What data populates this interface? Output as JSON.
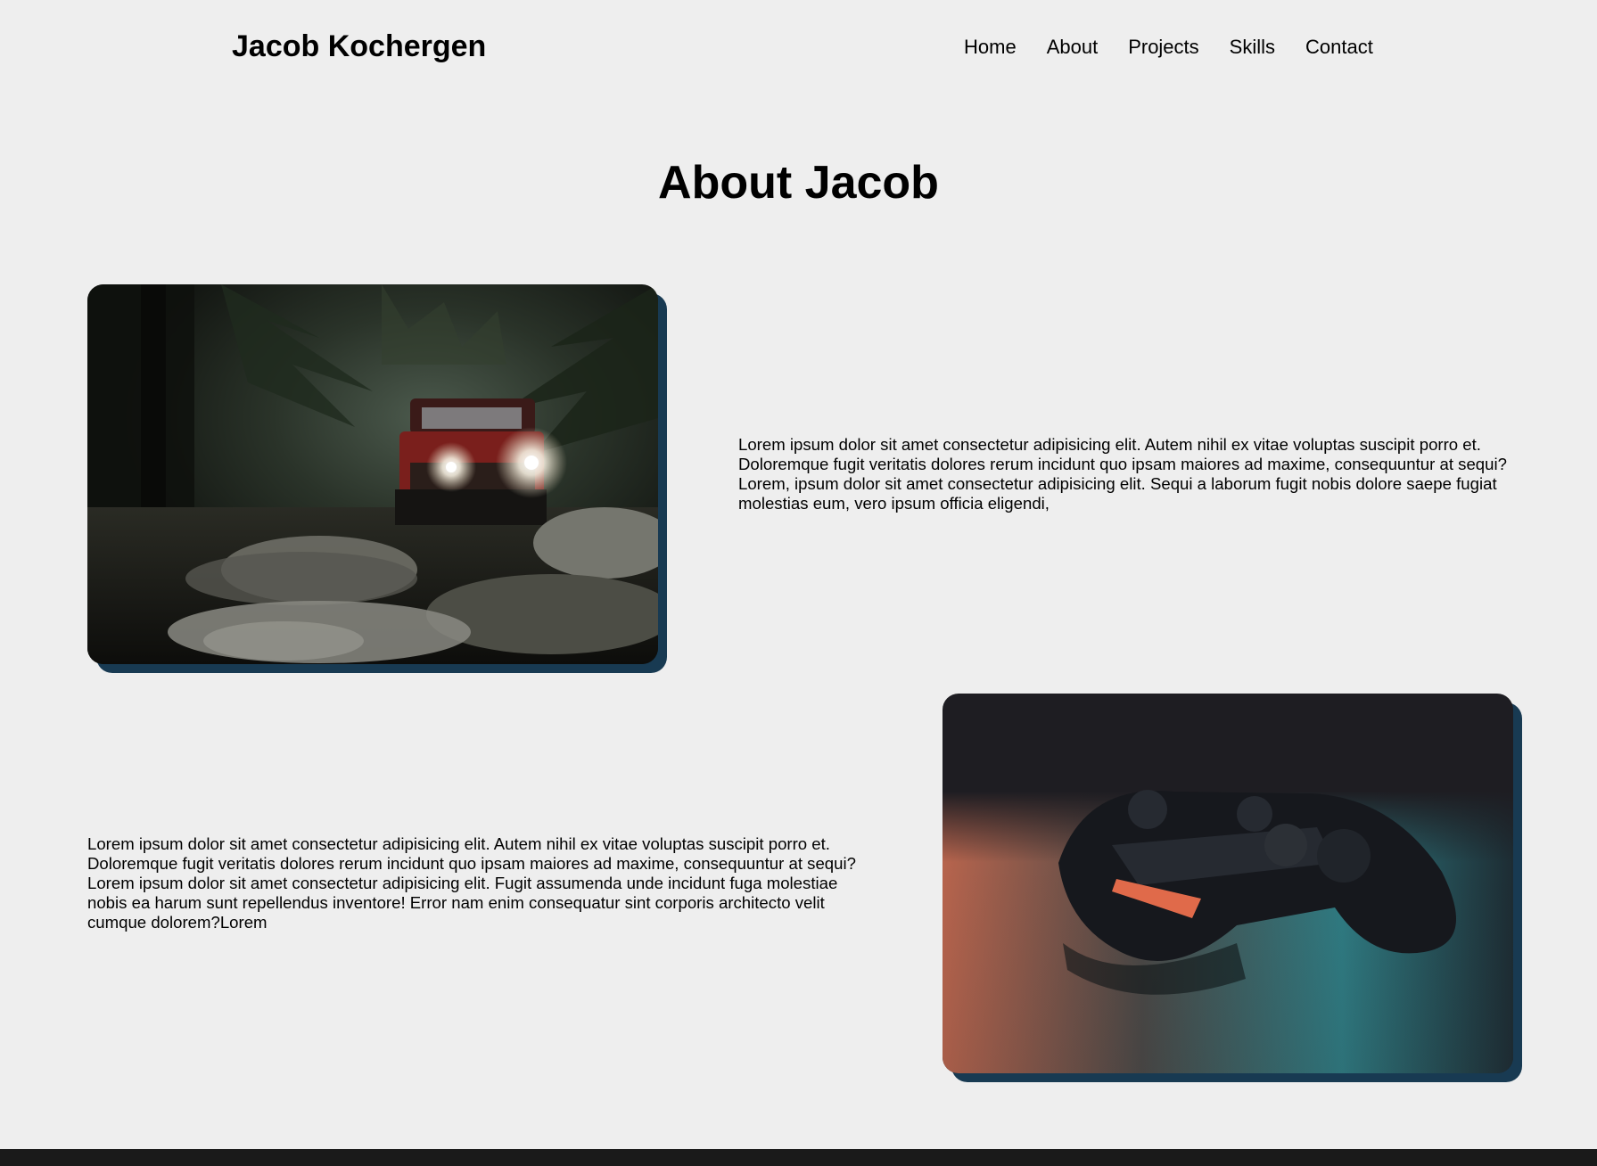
{
  "header": {
    "brand": "Jacob Kochergen",
    "nav": [
      "Home",
      "About",
      "Projects",
      "Skills",
      "Contact"
    ]
  },
  "main": {
    "title": "About Jacob",
    "sections": [
      {
        "image": "jeep-forest-photo",
        "text": "Lorem ipsum dolor sit amet consectetur adipisicing elit. Autem nihil ex vitae voluptas suscipit porro et. Doloremque fugit veritatis dolores rerum incidunt quo ipsam maiores ad maxime, consequuntur at sequi? Lorem, ipsum dolor sit amet consectetur adipisicing elit. Sequi a laborum fugit nobis dolore saepe fugiat molestias eum, vero ipsum officia eligendi,"
      },
      {
        "image": "game-controller-photo",
        "text": "Lorem ipsum dolor sit amet consectetur adipisicing elit. Autem nihil ex vitae voluptas suscipit porro et. Doloremque fugit veritatis dolores rerum incidunt quo ipsam maiores ad maxime, consequuntur at sequi? Lorem ipsum dolor sit amet consectetur adipisicing elit. Fugit assumenda unde incidunt fuga molestiae nobis ea harum sunt repellendus inventore! Error nam enim consequatur sint corporis architecto velit cumque dolorem?Lorem"
      }
    ]
  },
  "colors": {
    "background": "#eeeeee",
    "card_shadow": "#183a52",
    "footer": "#1a1a1a"
  }
}
